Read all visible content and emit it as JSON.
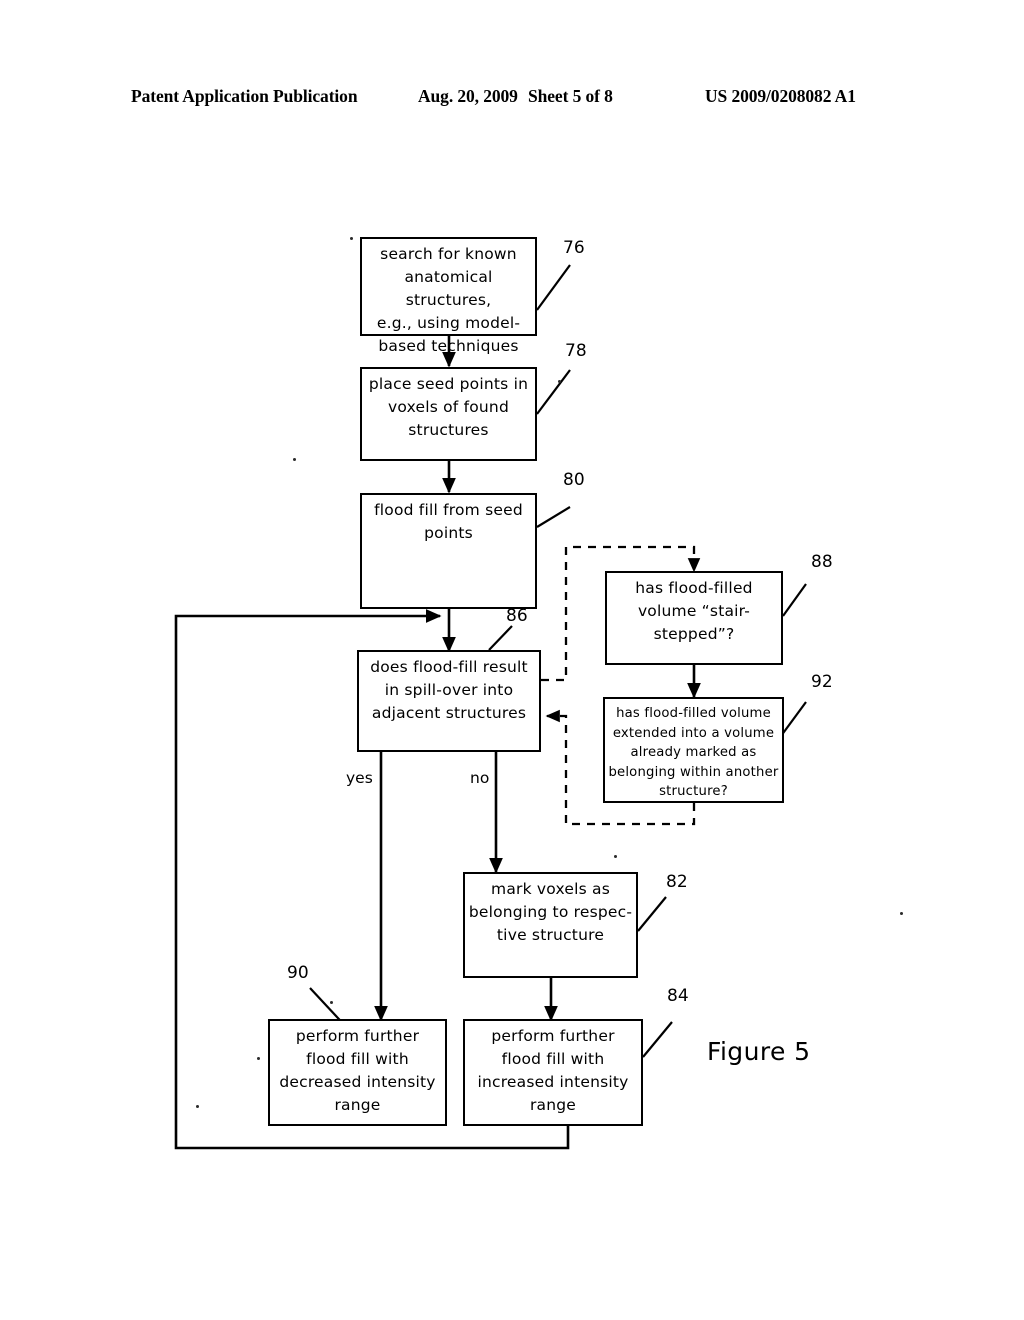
{
  "header": {
    "publication": "Patent Application Publication",
    "date": "Aug. 20, 2009",
    "sheet": "Sheet 5 of 8",
    "patent_number": "US 2009/0208082 A1"
  },
  "figure": {
    "caption": "Figure 5",
    "type": "flowchart",
    "boxes": [
      {
        "ref": "76",
        "name": "search-structures",
        "text": "search for known\nanatomical structures,\ne.g., using model-\nbased techniques"
      },
      {
        "ref": "78",
        "name": "place-seed-points",
        "text": "place seed points in\nvoxels of found\nstructures"
      },
      {
        "ref": "80",
        "name": "flood-fill-seed",
        "text": "flood fill from seed\npoints"
      },
      {
        "ref": "86",
        "name": "spill-over-decision",
        "text": "does flood-fill result\nin spill-over into\nadjacent structures"
      },
      {
        "ref": "88",
        "name": "stair-stepped-decision",
        "text": "has flood-filled\nvolume “stair-\nstepped”?"
      },
      {
        "ref": "92",
        "name": "extended-volume-decision",
        "text": "has flood-filled volume\nextended into a volume\nalready marked as\nbelonging within another\nstructure?"
      },
      {
        "ref": "82",
        "name": "mark-voxels",
        "text": "mark voxels as\nbelonging to respec-\ntive structure"
      },
      {
        "ref": "90",
        "name": "flood-fill-decreased",
        "text": "perform further\nflood fill with\ndecreased intensity\nrange"
      },
      {
        "ref": "84",
        "name": "flood-fill-increased",
        "text": "perform further\nflood fill with\nincreased intensity\nrange"
      }
    ],
    "branch_labels": {
      "yes": "yes",
      "no": "no"
    },
    "colors": {
      "ink": "#000000",
      "paper": "#ffffff"
    }
  }
}
